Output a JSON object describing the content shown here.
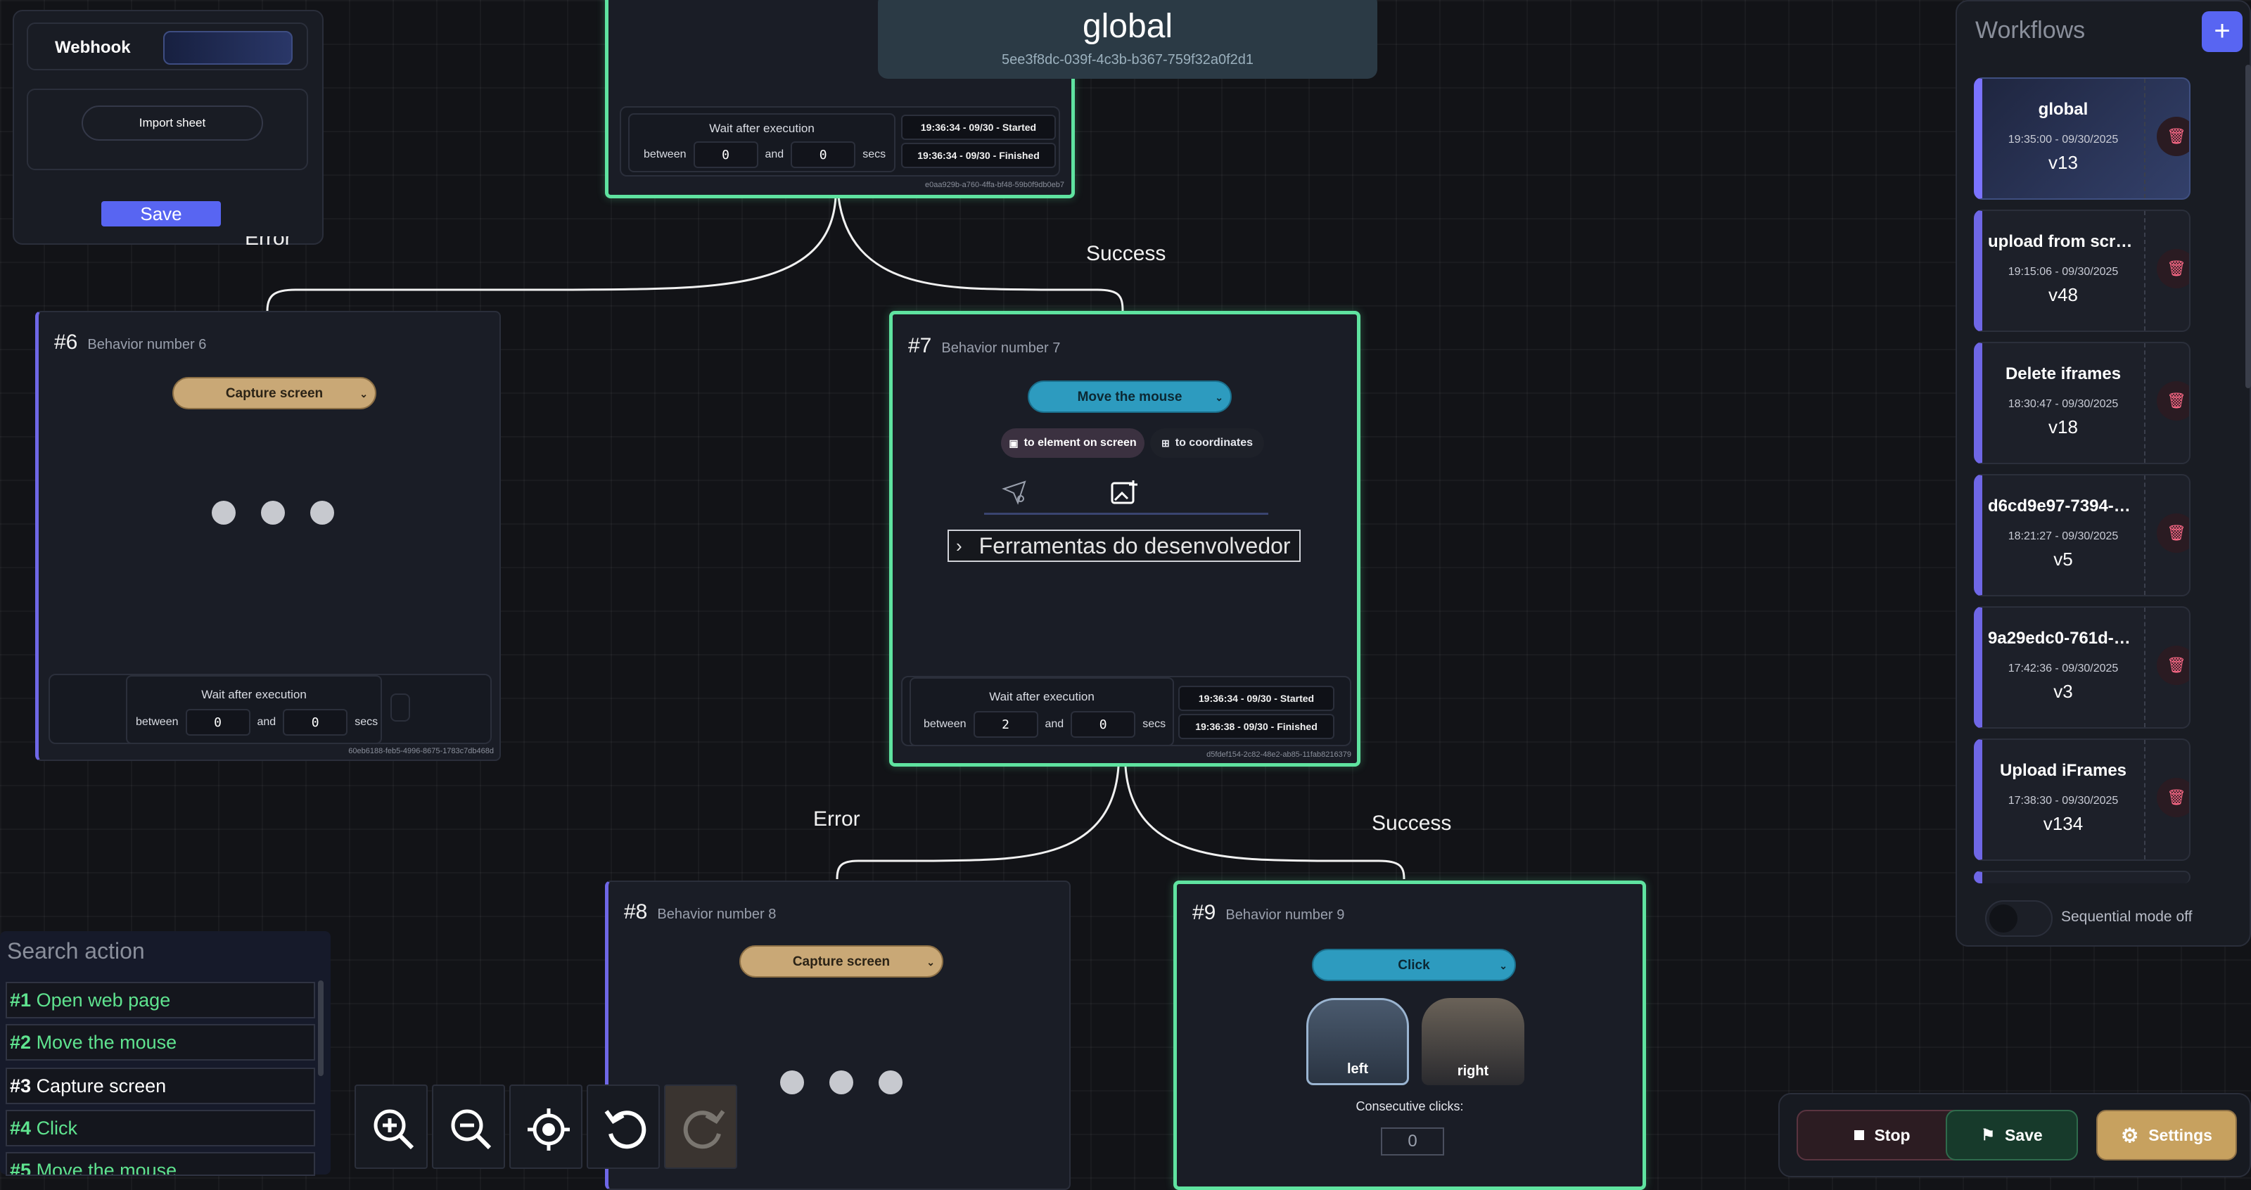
{
  "colors": {
    "background": "#121317",
    "active_border": "#5fe3a0",
    "accent": "#6f67e6",
    "tan_select": "#c9a876",
    "blue_select": "#2d9bbf",
    "stop": "#2c1c22",
    "save": "#173a2b",
    "settings": "#c7a15f"
  },
  "webhook_panel": {
    "webhook_label": "Webhook",
    "import_label": "Import sheet",
    "save_label": "Save",
    "edge_label_partial": "Error"
  },
  "global_header": {
    "title": "global",
    "id": "5ee3f8dc-039f-4c3b-b367-759f32a0f2d1"
  },
  "top_node": {
    "wait_title": "Wait after execution",
    "between": "between",
    "and": "and",
    "secs": "secs",
    "min": "0",
    "max": "0",
    "started": "19:36:34 - 09/30 - Started",
    "finished": "19:36:34 - 09/30 - Finished",
    "id": "e0aa929b-a760-4ffa-bf48-59b0f9db0eb7"
  },
  "edges": {
    "success_top": "Success",
    "error_mid": "Error",
    "success_mid": "Success"
  },
  "node6": {
    "num": "#6",
    "subtitle": "Behavior number 6",
    "action": "Capture screen",
    "wait_title": "Wait after execution",
    "between": "between",
    "and": "and",
    "secs": "secs",
    "min": "0",
    "max": "0",
    "id": "60eb6188-feb5-4996-8675-1783c7db468d"
  },
  "node7": {
    "num": "#7",
    "subtitle": "Behavior number 7",
    "action": "Move the mouse",
    "opt_element": "to element on screen",
    "opt_coords": "to coordinates",
    "target_text": "Ferramentas do desenvolvedor",
    "wait_title": "Wait after execution",
    "between": "between",
    "and": "and",
    "secs": "secs",
    "min": "2",
    "max": "0",
    "started": "19:36:34 - 09/30 - Started",
    "finished": "19:36:38 - 09/30 - Finished",
    "id": "d5fdef154-2c82-48e2-ab85-11fab8216379"
  },
  "node8": {
    "num": "#8",
    "subtitle": "Behavior number 8",
    "action": "Capture screen"
  },
  "node9": {
    "num": "#9",
    "subtitle": "Behavior number 9",
    "action": "Click",
    "left_label": "left",
    "right_label": "right",
    "consecutive_label": "Consecutive clicks:",
    "consecutive_value": "0"
  },
  "sidebar": {
    "title": "Workflows",
    "add_symbol": "+",
    "items": [
      {
        "name": "global",
        "time": "19:35:00 - 09/30/2025",
        "version": "v13"
      },
      {
        "name": "upload from scratch",
        "time": "19:15:06 - 09/30/2025",
        "version": "v48"
      },
      {
        "name": "Delete iframes",
        "time": "18:30:47 - 09/30/2025",
        "version": "v18"
      },
      {
        "name": "d6cd9e97-7394-46c...",
        "time": "18:21:27 - 09/30/2025",
        "version": "v5"
      },
      {
        "name": "9a29edc0-761d-4a0...",
        "time": "17:42:36 - 09/30/2025",
        "version": "v3"
      },
      {
        "name": "Upload iFrames",
        "time": "17:38:30 - 09/30/2025",
        "version": "v134"
      }
    ],
    "sequential_label": "Sequential mode off",
    "sequential_on": false
  },
  "search": {
    "placeholder": "Search action",
    "items": [
      {
        "num": "#1",
        "label": "Open web page"
      },
      {
        "num": "#2",
        "label": "Move the mouse"
      },
      {
        "num": "#3",
        "label": "Capture screen"
      },
      {
        "num": "#4",
        "label": "Click"
      },
      {
        "num": "#5",
        "label": "Move the mouse"
      }
    ]
  },
  "actions": {
    "stop": "Stop",
    "save": "Save",
    "settings": "Settings"
  }
}
